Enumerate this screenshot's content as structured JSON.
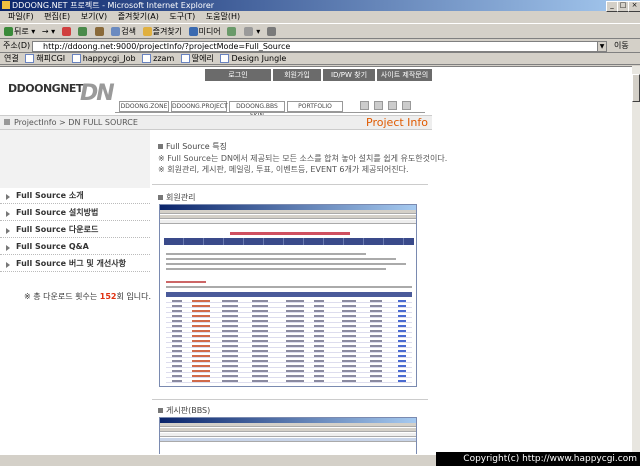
{
  "window": {
    "title": "DDOONG.NET 프로젝트 - Microsoft Internet Explorer"
  },
  "menu": [
    "파일(F)",
    "편집(E)",
    "보기(V)",
    "즐겨찾기(A)",
    "도구(T)",
    "도움말(H)"
  ],
  "toolbar": {
    "back": "뒤로",
    "search": "검색",
    "favorites": "즐겨찾기",
    "media": "미디어"
  },
  "address": {
    "label": "주소(D)",
    "url": "http://ddoong.net:9000/projectInfo/?projectMode=Full_Source",
    "go": "이동"
  },
  "links": {
    "label": "연결",
    "items": [
      "해피CGI",
      "happycgi_Job",
      "zzam",
      "딸에리",
      "Design Jungle"
    ]
  },
  "site": {
    "logo_text": "DDOONGNET",
    "logo_dn": "DN",
    "top_nav": [
      "로그인",
      "회원가입",
      "ID/PW 찾기",
      "사이트 제작문의"
    ],
    "sub_nav": [
      "DDOONG.ZONE",
      "DDOONG.PROJECT",
      "DDOONG.BBS SKIN",
      "PORTFOLIO"
    ],
    "breadcrumb": "ProjectInfo > DN FULL SOURCE",
    "page_title": "Project Info",
    "sidebar": [
      "Full Source 소개",
      "Full Source 설치방법",
      "Full Source 다운로드",
      "Full Source Q&A",
      "Full Source 버그 및 개선사항"
    ],
    "download_prefix": "※ 총 다운로드 횟수는 ",
    "download_count": "152",
    "download_suffix": "회 입니다.",
    "feature_heading": "Full Source 특징",
    "feature_lines": [
      "※ Full Source는 DN에서 제공되는 모든 소스를 합쳐 놓아 설치를 쉽게 유도한것이다.",
      "※ 회원관리, 게시판, 메일링, 투표, 이벤트등, EVENT 6개가 제공되어진다."
    ],
    "members_heading": "회원관리",
    "board_heading": "게시판(BBS)"
  },
  "status": {
    "copyright": "Copyright(c) http://www.happycgi.com"
  }
}
